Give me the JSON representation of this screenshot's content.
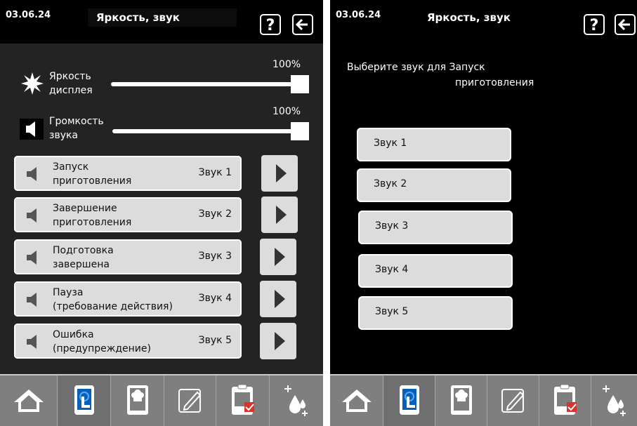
{
  "left": {
    "date": "03.06.24",
    "title": "Яркость, звук",
    "help_icon": "question-icon",
    "back_icon": "arrow-left-icon",
    "brightness": {
      "label_1": "Яркость",
      "label_2": "дисплея",
      "percent": "100%",
      "value": 1.0
    },
    "volume": {
      "label_1": "Громкость",
      "label_2": "звука",
      "percent": "100%",
      "value": 1.0
    },
    "sound_rows": [
      {
        "event_1": "Запуск",
        "event_2": "приготовления",
        "sound": "Звук 1"
      },
      {
        "event_1": "Завершение",
        "event_2": "приготовления",
        "sound": "Звук 2"
      },
      {
        "event_1": "Подготовка",
        "event_2": "завершена",
        "sound": "Звук 3"
      },
      {
        "event_1": "Пауза",
        "event_2": "(требование действия)",
        "sound": "Звук 4"
      },
      {
        "event_1": "Ошибка",
        "event_2": "(предупреждение)",
        "sound": "Звук 5"
      }
    ]
  },
  "right": {
    "date": "03.06.24",
    "title": "Яркость, звук",
    "prompt_1": "Выберите звук для Запуск",
    "prompt_2": "приготовления",
    "options": [
      "Звук 1",
      "Звук 2",
      "Звук 3",
      "Звук 4",
      "Звук 5"
    ]
  },
  "navbar": {
    "items": [
      "home-icon",
      "touch-tablet-icon",
      "cookbook-icon",
      "edit-icon",
      "clipboard-check-icon",
      "cleaning-drops-icon"
    ]
  },
  "colors": {
    "button_fill": "#dcdcdc",
    "nav_bar": "#7f7f7f",
    "nav_blue": "#0a5fb4",
    "accent_red": "#d9342b"
  }
}
